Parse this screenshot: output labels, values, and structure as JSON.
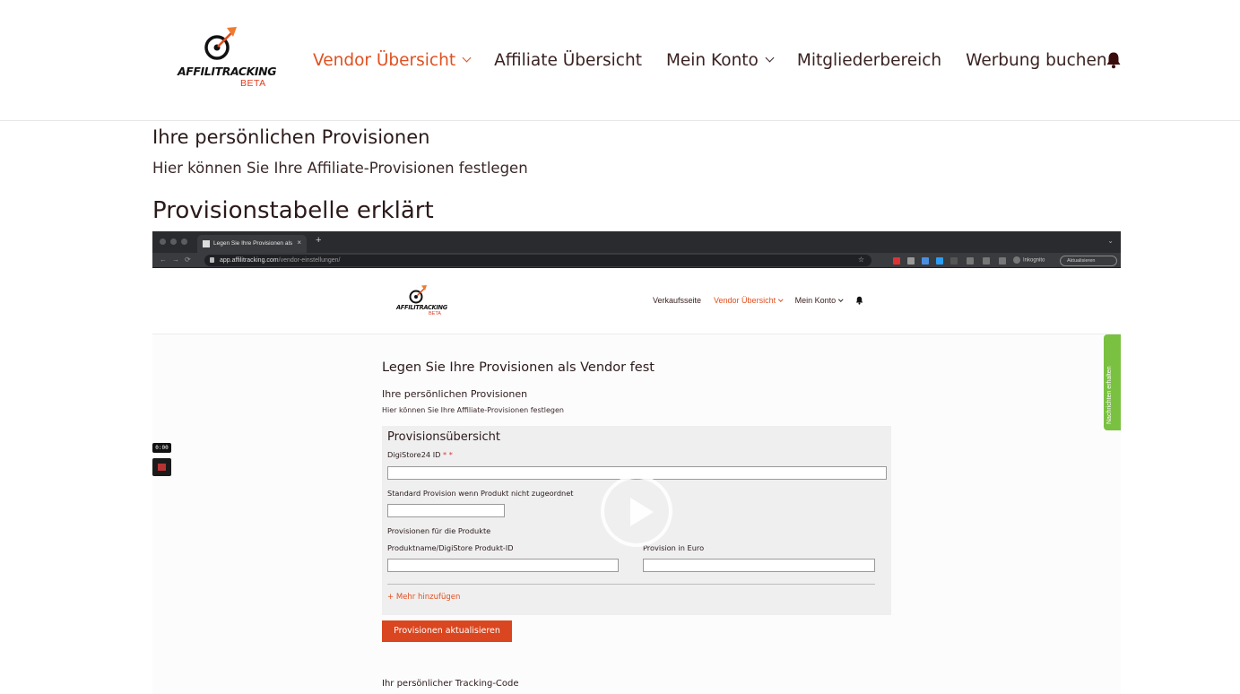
{
  "header": {
    "logo_text": "AFFILITRACKING",
    "logo_badge": "BETA",
    "nav": [
      {
        "label": "Vendor Übersicht",
        "dropdown": true,
        "active": true
      },
      {
        "label": "Affiliate Übersicht",
        "dropdown": false,
        "active": false
      },
      {
        "label": "Mein Konto",
        "dropdown": true,
        "active": false
      },
      {
        "label": "Mitgliederbereich",
        "dropdown": false,
        "active": false
      },
      {
        "label": "Werbung buchen",
        "dropdown": false,
        "active": false
      }
    ],
    "bell_icon": "bell-icon"
  },
  "content": {
    "heading": "Ihre persönlichen Provisionen",
    "description": "Hier können Sie Ihre Affiliate-Provisionen festlegen",
    "section_heading": "Provisionstabelle erklärt"
  },
  "video": {
    "browser": {
      "tab_title": "Legen Sie Ihre Provisionen als",
      "tab_close": "×",
      "new_tab": "+",
      "url_host": "app.affilitracking.com",
      "url_path": "/vendor-einstellungen/",
      "incognito": "Inkognito",
      "update_label": "Aktualisieren"
    },
    "inner_header": {
      "logo_text": "AFFILITRACKING",
      "logo_badge": "BETA",
      "nav": [
        {
          "label": "Verkaufsseite",
          "dropdown": false,
          "active": false
        },
        {
          "label": "Vendor Übersicht",
          "dropdown": true,
          "active": true
        },
        {
          "label": "Mein Konto",
          "dropdown": true,
          "active": false
        }
      ]
    },
    "side_tab": "Nachrichten erhalten",
    "timestamp": "0:00",
    "page": {
      "title": "Legen Sie Ihre Provisionen als Vendor fest",
      "subtitle": "Ihre persönlichen Provisionen",
      "description": "Hier können Sie Ihre Affiliate-Provisionen festlegen",
      "panel_title": "Provisionsübersicht",
      "digistore_label": "DigiStore24 ID",
      "digistore_required": "* *",
      "standard_label": "Standard Provision wenn Produkt nicht zugeordnet",
      "products_label": "Provisionen für die Produkte",
      "product_name_label": "Produktname/DigiStore Produkt-ID",
      "product_euro_label": "Provision in Euro",
      "add_more": "+ Mehr hinzufügen",
      "submit": "Provisionen aktualisieren",
      "tracking_heading": "Ihr persönlicher Tracking-Code"
    }
  },
  "colors": {
    "accent": "#e0501f",
    "button": "#d9461f",
    "side_tab": "#7ac142",
    "text": "#2b1a1a"
  }
}
